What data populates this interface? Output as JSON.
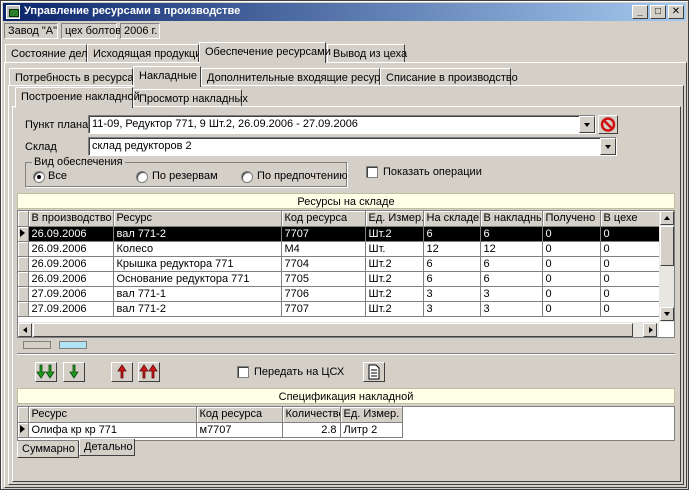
{
  "window": {
    "title": "Управление ресурсами в производстве",
    "minimize_glyph": "_",
    "maximize_glyph": "□",
    "close_glyph": "✕"
  },
  "header_info": {
    "plant": "Завод \"А\"",
    "workshop": "цех болтов",
    "year": "2006 г."
  },
  "top_tabs": [
    {
      "label": "Состояние дел"
    },
    {
      "label": "Исходящая продукция"
    },
    {
      "label": "Обеспечение ресурсами"
    },
    {
      "label": "Вывод из цеха"
    }
  ],
  "top_tabs_selected": "Обеспечение ресурсами",
  "second_tabs": [
    {
      "label": "Потребность в ресурсах"
    },
    {
      "label": "Накладные"
    },
    {
      "label": "Дополнительные входящие ресурсы"
    },
    {
      "label": "Списание в производство"
    }
  ],
  "second_tabs_selected": "Накладные",
  "third_tabs": [
    {
      "label": "Построение накладной"
    },
    {
      "label": "Просмотр накладных"
    }
  ],
  "third_tabs_selected": "Построение накладной",
  "form": {
    "plan_label": "Пункт плана",
    "plan_value": "11-09, Редуктор 771, 9 Шт.2, 26.09.2006 - 27.09.2006",
    "warehouse_label": "Склад",
    "warehouse_value": "склад редукторов 2"
  },
  "supply_type": {
    "legend": "Вид обеспечения",
    "options": [
      {
        "label": "Все",
        "selected": true
      },
      {
        "label": "По резервам",
        "selected": false
      },
      {
        "label": "По предпочтению",
        "selected": false
      }
    ]
  },
  "show_operations": {
    "label": "Показать операции",
    "checked": false
  },
  "stock_grid": {
    "caption": "Ресурсы на складе",
    "columns": [
      "В производство",
      "Ресурс",
      "Код ресурса",
      "Ед. Измер.",
      "На складе",
      "В накладных",
      "Получено",
      "В цехе"
    ],
    "rows": [
      [
        "26.09.2006",
        "вал 771-2",
        "7707",
        "Шт.2",
        "6",
        "6",
        "0",
        "0"
      ],
      [
        "26.09.2006",
        "Колесо",
        "M4",
        "Шт.",
        "12",
        "12",
        "0",
        "0"
      ],
      [
        "26.09.2006",
        "Крышка редуктора 771",
        "7704",
        "Шт.2",
        "6",
        "6",
        "0",
        "0"
      ],
      [
        "26.09.2006",
        "Основание редуктора 771",
        "7705",
        "Шт.2",
        "6",
        "6",
        "0",
        "0"
      ],
      [
        "27.09.2006",
        "вал 771-1",
        "7706",
        "Шт.2",
        "3",
        "3",
        "0",
        "0"
      ],
      [
        "27.09.2006",
        "вал 771-2",
        "7707",
        "Шт.2",
        "3",
        "3",
        "0",
        "0"
      ]
    ],
    "selected_row": 0
  },
  "toolbar": {
    "add_all_icon": "double-down-arrow-green",
    "add_one_icon": "down-arrow-green",
    "remove_one_icon": "up-arrow-red",
    "remove_all_icon": "double-up-arrow-red",
    "transfer_label": "Передать на ЦСХ",
    "transfer_checked": false,
    "doc_icon": "document-icon"
  },
  "spec_grid": {
    "caption": "Спецификация накладной",
    "columns": [
      "Ресурс",
      "Код ресурса",
      "Количество",
      "Ед. Измер."
    ],
    "rows": [
      [
        "Олифа кр кр 771",
        "м7707",
        "2.8",
        "Литр 2"
      ]
    ]
  },
  "bottom_tabs": [
    {
      "label": "Суммарно"
    },
    {
      "label": "Детально"
    }
  ],
  "bottom_tabs_selected": "Суммарно",
  "colors": {
    "title_gradient_start": "#0a246a",
    "title_gradient_end": "#a6caf0",
    "face": "#d4d0c8",
    "caption_bg": "#ffffe8",
    "selected_row": "#000000",
    "clear_icon_red": "#d01010",
    "arrow_green": "#1e9a1e",
    "arrow_red": "#d01818"
  }
}
